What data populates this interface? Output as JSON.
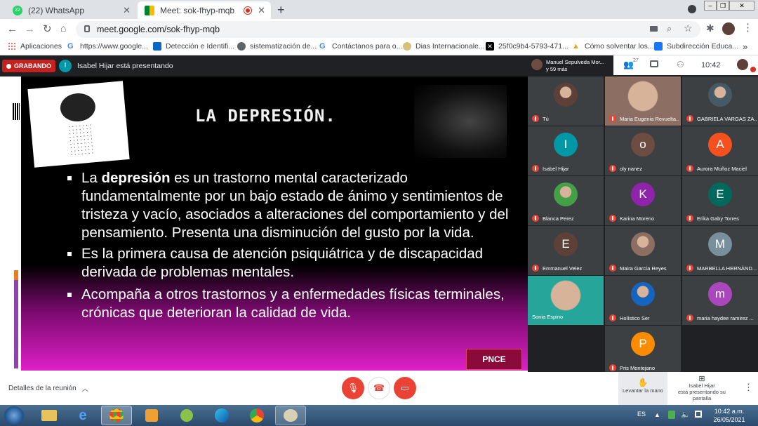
{
  "browser": {
    "tabs": [
      {
        "label": "(22) WhatsApp",
        "badge": "22",
        "active": false
      },
      {
        "label": "Meet: sok-fhyp-mqb",
        "active": true
      }
    ],
    "new_tab_icon": "plus-icon",
    "url": "meet.google.com/sok-fhyp-mqb",
    "bookmarks": [
      {
        "label": "Aplicaciones",
        "icon": "apps-grid-icon"
      },
      {
        "label": "https://www.google...",
        "icon": "google-icon"
      },
      {
        "label": "Detección e Identifi...",
        "icon": "linkedin-icon"
      },
      {
        "label": "sistematización de...",
        "icon": "globe-icon"
      },
      {
        "label": "Contáctanos para o...",
        "icon": "google-icon"
      },
      {
        "label": "Dias Internacionale...",
        "icon": "calendar-icon"
      },
      {
        "label": "25f0c9b4-5793-471...",
        "icon": "x-icon"
      },
      {
        "label": "Cómo solventar los...",
        "icon": "warning-icon"
      },
      {
        "label": "Subdirección Educa...",
        "icon": "facebook-icon"
      }
    ],
    "bookmarks_more": "»"
  },
  "meet": {
    "recording_label": "GRABANDO",
    "presenter_initial": "I",
    "presenter_text": "Isabel Hijar está presentando",
    "host_name": "Manuel Sepulveda Mor...",
    "host_more": "y 59 más",
    "people_count": "27",
    "chat_badge": "",
    "time": "10:42",
    "slide": {
      "title": "LA DEPRESIÓN.",
      "bullets": [
        {
          "pre": "La ",
          "bold": "depresión",
          "post": " es un trastorno mental caracterizado fundamentalmente por un bajo estado de ánimo y sentimientos de tristeza y vacío, asociados a alteraciones del comportamiento y del pensamiento. Presenta una disminución del gusto por la vida."
        },
        {
          "pre": "Es la primera causa de atención psiquiátrica y de discapacidad derivada de problemas mentales.",
          "bold": "",
          "post": ""
        },
        {
          "pre": "Acompaña a otros trastornos y a enfermedades físicas terminales, crónicas que deterioran la calidad de vida.",
          "bold": "",
          "post": ""
        }
      ],
      "logo_text": "PNCE"
    },
    "participants": [
      {
        "name": "Tú",
        "initial": "",
        "color": "#5d4037",
        "photo": true
      },
      {
        "name": "Maria Eugenia Revuelta...",
        "initial": "",
        "color": "#8d6e63",
        "photo": true
      },
      {
        "name": "GABRIELA VARGAS ZA...",
        "initial": "",
        "color": "#455a64",
        "photo": true
      },
      {
        "name": "Isabel Hijar",
        "initial": "I",
        "color": "#0097a7"
      },
      {
        "name": "oly nanez",
        "initial": "o",
        "color": "#6d4c41"
      },
      {
        "name": "Aurora Muñoz Maciel",
        "initial": "A",
        "color": "#f4511e"
      },
      {
        "name": "Blanca Perez",
        "initial": "",
        "color": "#43a047",
        "photo": true
      },
      {
        "name": "Karina Moreno",
        "initial": "K",
        "color": "#8e24aa"
      },
      {
        "name": "Erika Gaby Torres",
        "initial": "E",
        "color": "#00695c"
      },
      {
        "name": "Emmanuel Velez",
        "initial": "E",
        "color": "#5d4037"
      },
      {
        "name": "Maira García Reyes",
        "initial": "",
        "color": "#8d6e63",
        "photo": true
      },
      {
        "name": "MARBELLA HERNÁND...",
        "initial": "M",
        "color": "#78909c"
      },
      {
        "name": "Sonia Espino",
        "initial": "",
        "color": "#26a69a",
        "photo": true
      },
      {
        "name": "Holístico Ser",
        "initial": "",
        "color": "#1565c0",
        "photo": true
      },
      {
        "name": "maria haydee ramirez ...",
        "initial": "m",
        "color": "#ab47bc"
      },
      {
        "name": "Pris Montejano",
        "initial": "P",
        "color": "#fb8c00"
      }
    ],
    "details_label": "Detalles de la reunión",
    "raise_hand_label": "Levantar la mano",
    "presenting_label_1": "Isabel Hijar",
    "presenting_label_2": "está presentando su pantalla"
  },
  "taskbar": {
    "lang": "ES",
    "time": "10:42 a.m.",
    "date": "26/05/2021"
  }
}
